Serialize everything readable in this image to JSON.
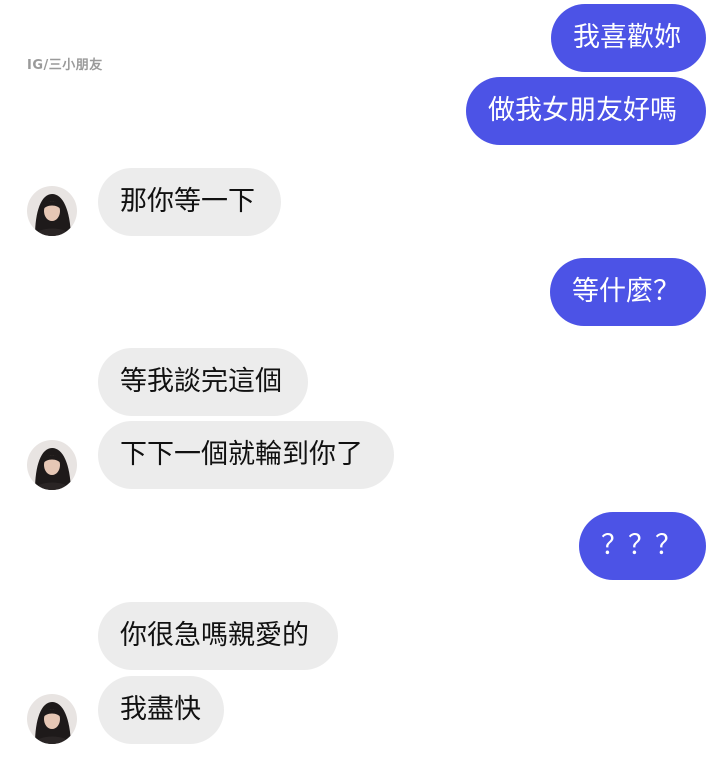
{
  "watermark": "IG/三小朋友",
  "messages": {
    "m1": "我喜歡妳",
    "m2": "做我女朋友好嗎",
    "m3": "那你等一下",
    "m4": "等什麼？",
    "m5": "等我談完這個",
    "m6": "下下一個就輪到你了",
    "m7": "？？？",
    "m8": "你很急嗎親愛的",
    "m9": "我盡快"
  },
  "colors": {
    "outgoing_bubble": "#4c53e6",
    "incoming_bubble": "#ececec"
  }
}
